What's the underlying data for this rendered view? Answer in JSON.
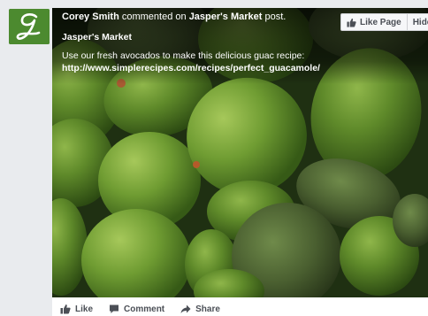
{
  "post": {
    "author": "Corey Smith",
    "action_text": "commented on",
    "page": "Jasper's Market",
    "object": "post.",
    "page_name": "Jasper's Market",
    "body": "Use our fresh avocados to make this delicious guac recipe:",
    "link": "http://www.simplerecipes.com/recipes/perfect_guacamole/",
    "buttons": {
      "like_page": "Like Page",
      "hide": "Hide"
    },
    "actions": {
      "like": "Like",
      "comment": "Comment",
      "share": "Share"
    }
  },
  "avatar": {
    "letter_icon": "script-g-logo-icon",
    "color": "#4c8a2f"
  },
  "photo": {
    "subject": "avocado-photo"
  }
}
